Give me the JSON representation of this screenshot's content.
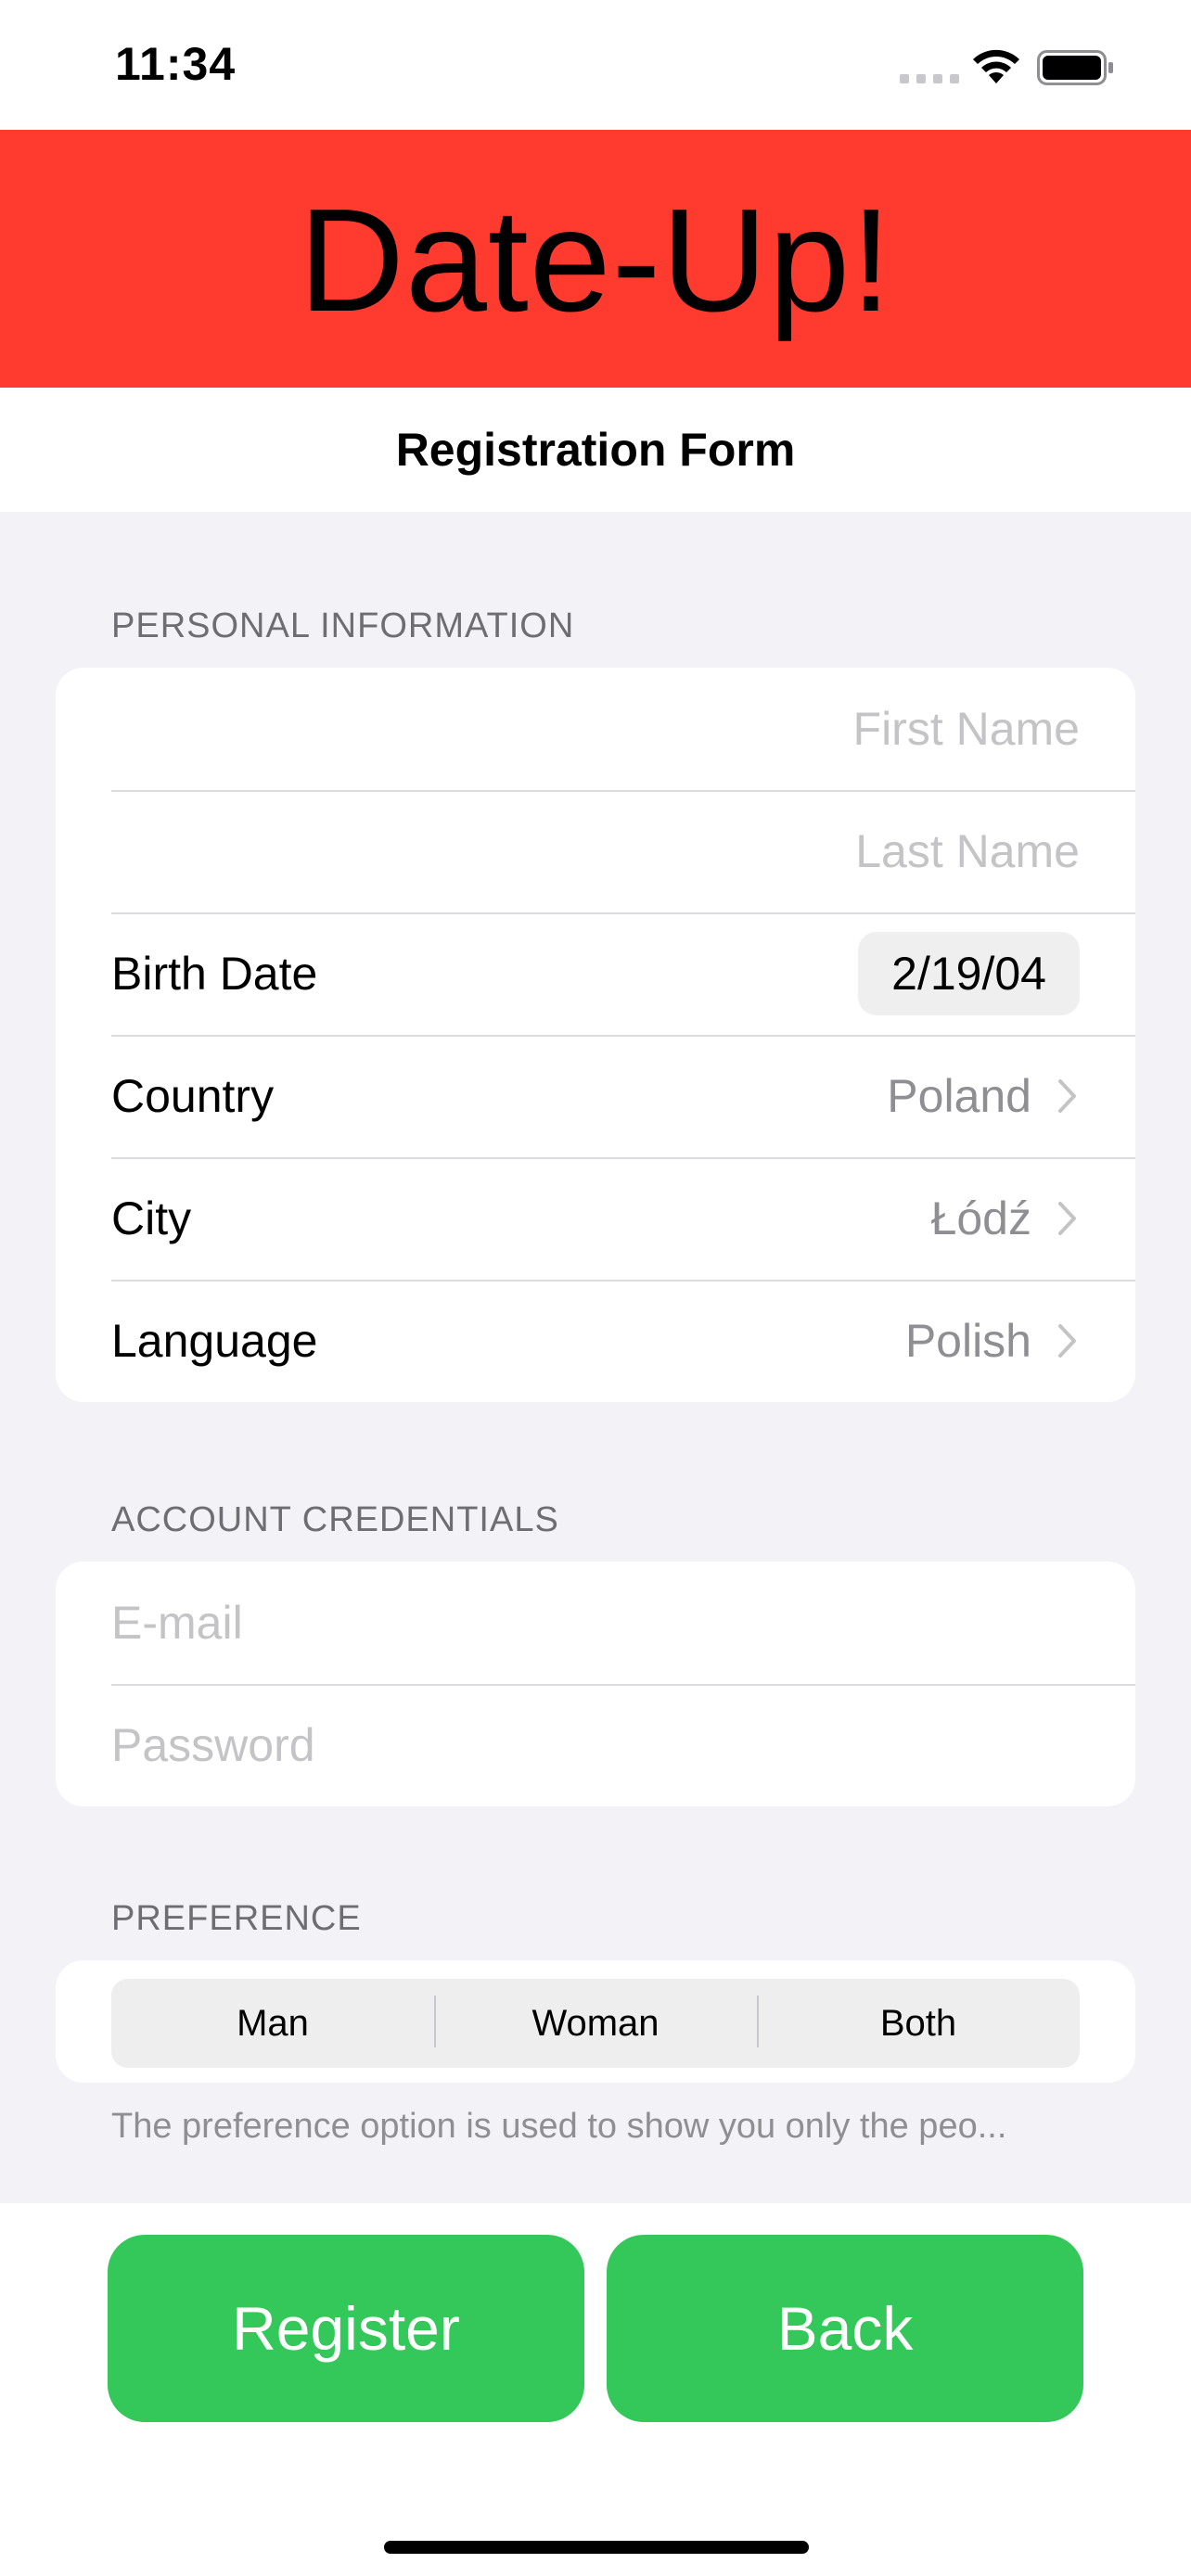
{
  "status_bar": {
    "time": "11:34"
  },
  "app": {
    "title": "Date-Up!",
    "brand_color": "#ff3b30"
  },
  "nav": {
    "title": "Registration Form"
  },
  "personal": {
    "header": "PERSONAL INFORMATION",
    "first_name_placeholder": "First Name",
    "last_name_placeholder": "Last Name",
    "birth_date_label": "Birth Date",
    "birth_date_value": "2/19/04",
    "country_label": "Country",
    "country_value": "Poland",
    "city_label": "City",
    "city_value": "Łódź",
    "language_label": "Language",
    "language_value": "Polish"
  },
  "credentials": {
    "header": "ACCOUNT CREDENTIALS",
    "email_placeholder": "E-mail",
    "password_placeholder": "Password"
  },
  "preference": {
    "header": "PREFERENCE",
    "options": [
      "Man",
      "Woman",
      "Both"
    ],
    "footer": "The preference option is used to show you only the peo..."
  },
  "actions": {
    "register_label": "Register",
    "back_label": "Back",
    "button_color": "#34c759"
  }
}
